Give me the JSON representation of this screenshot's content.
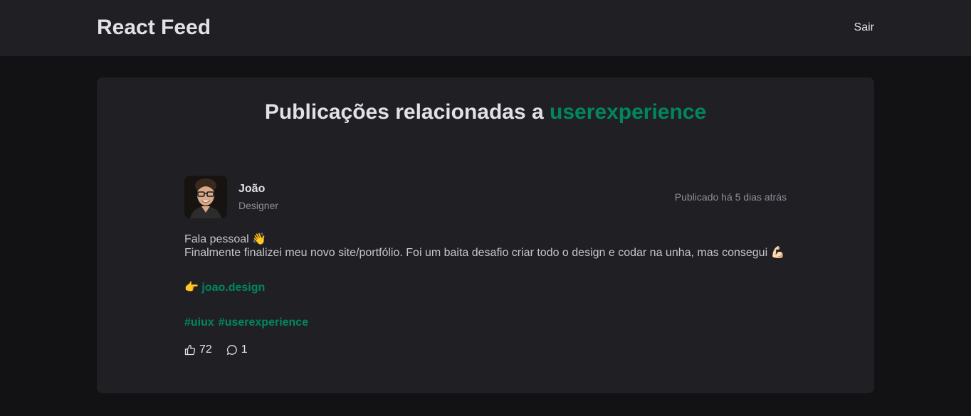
{
  "header": {
    "title": "React Feed",
    "logout_label": "Sair"
  },
  "page": {
    "heading_prefix": "Publicações relacionadas a ",
    "heading_tag": "userexperience"
  },
  "post": {
    "author": {
      "name": "João",
      "role": "Designer"
    },
    "published_label": "Publicado há 5 dias atrás",
    "content": {
      "line1": "Fala pessoal 👋",
      "line2": "Finalmente finalizei meu novo site/portfólio. Foi um baita desafio criar todo o design e codar na unha, mas consegui 💪🏻",
      "link_emoji": "👉 ",
      "link_text": "joao.design",
      "hashtags": [
        "#uiux",
        "#userexperience"
      ]
    },
    "likes_count": "72",
    "comments_count": "1"
  },
  "colors": {
    "background": "#121214",
    "surface": "#202024",
    "accent": "#00875f",
    "text": "#e1e1e6",
    "muted": "#8d8d99"
  },
  "icons": {
    "like": "thumbs-up-icon",
    "comment": "chat-bubble-icon"
  }
}
